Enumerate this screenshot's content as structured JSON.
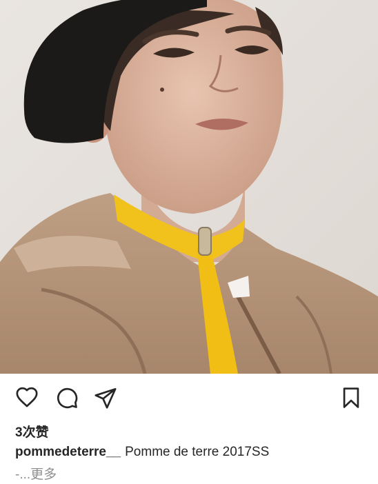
{
  "post": {
    "photo_icon": "portrait-photo",
    "actions": {
      "like_icon": "heart-icon",
      "comment_icon": "comment-icon",
      "share_icon": "share-icon",
      "save_icon": "bookmark-icon"
    },
    "likes_text": "3次赞",
    "caption": {
      "username": "pommedeterre__",
      "text": "Pomme de terre 2017SS"
    },
    "more_prefix": "-...",
    "more_label": "更多"
  },
  "colors": {
    "text": "#262626",
    "muted": "#8e8e8e",
    "background": "#ffffff"
  }
}
